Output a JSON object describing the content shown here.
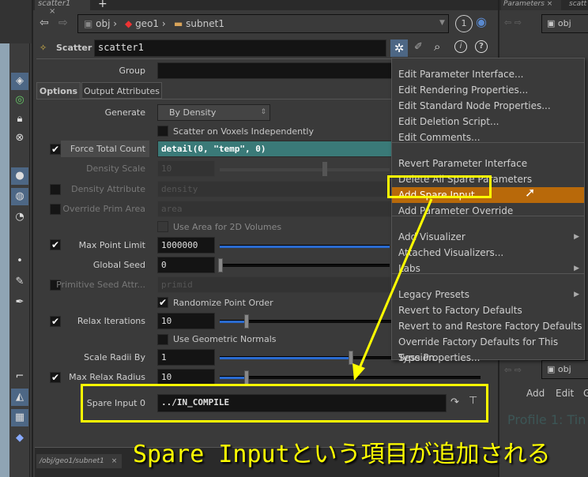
{
  "tabs": {
    "main": "scatter1",
    "main_close": "×",
    "add": "+",
    "right": "Parameters",
    "right_close": "×",
    "right2": "scatt",
    "bottom": "/obj/geo1/subnet1",
    "bottom_close": "×"
  },
  "path": {
    "obj": "obj",
    "geo1": "geo1",
    "subnet1": "subnet1",
    "badge": "1"
  },
  "node": {
    "type": "Scatter",
    "name": "scatter1"
  },
  "params": {
    "group": "Group",
    "tab_options": "Options",
    "tab_output": "Output Attributes",
    "generate_label": "Generate",
    "generate_value": "By Density",
    "voxels": "Scatter on Voxels Independently",
    "force_label": "Force Total Count",
    "force_value": "detail(0, \"temp\", 0)",
    "density_scale_label": "Density Scale",
    "density_scale_value": "10",
    "density_attr_label": "Density Attribute",
    "density_attr_value": "density",
    "override_label": "Override Prim Area",
    "override_value": "area",
    "use_area": "Use Area for 2D Volumes",
    "max_point_label": "Max Point Limit",
    "max_point_value": "1000000",
    "seed_label": "Global Seed",
    "seed_value": "0",
    "prim_seed_label": "Primitive Seed Attr...",
    "prim_seed_value": "primid",
    "randomize": "Randomize Point Order",
    "relax_label": "Relax Iterations",
    "relax_value": "10",
    "geo_normals": "Use Geometric Normals",
    "scale_radii_label": "Scale Radii By",
    "scale_radii_value": "1",
    "max_relax_label": "Max Relax Radius",
    "max_relax_value": "10",
    "spare_label": "Spare Input 0",
    "spare_value": "../IN_COMPILE"
  },
  "menu": [
    "Edit Parameter Interface...",
    "Edit Rendering Properties...",
    "Edit Standard Node Properties...",
    "Edit Deletion Script...",
    "Edit Comments...",
    "Revert Parameter Interface",
    "Delete All Spare Parameters",
    "Add Spare Input",
    "Add Parameter Override",
    "Add Visualizer",
    "Attached Visualizers...",
    "Labs",
    "Legacy Presets",
    "Revert to Factory Defaults",
    "Revert to and Restore Factory Defaults",
    "Override Factory Defaults for This Session",
    "Type Properties..."
  ],
  "right": {
    "obj": "obj",
    "add": "Add",
    "edit": "Edit",
    "g": "G",
    "profile": "Profile 1: Tin"
  },
  "caption": "Spare Inputという項目が追加される",
  "colors": {
    "highlight": "#b8690a",
    "annotation": "#ffff00",
    "expression": "#3a7a78"
  }
}
